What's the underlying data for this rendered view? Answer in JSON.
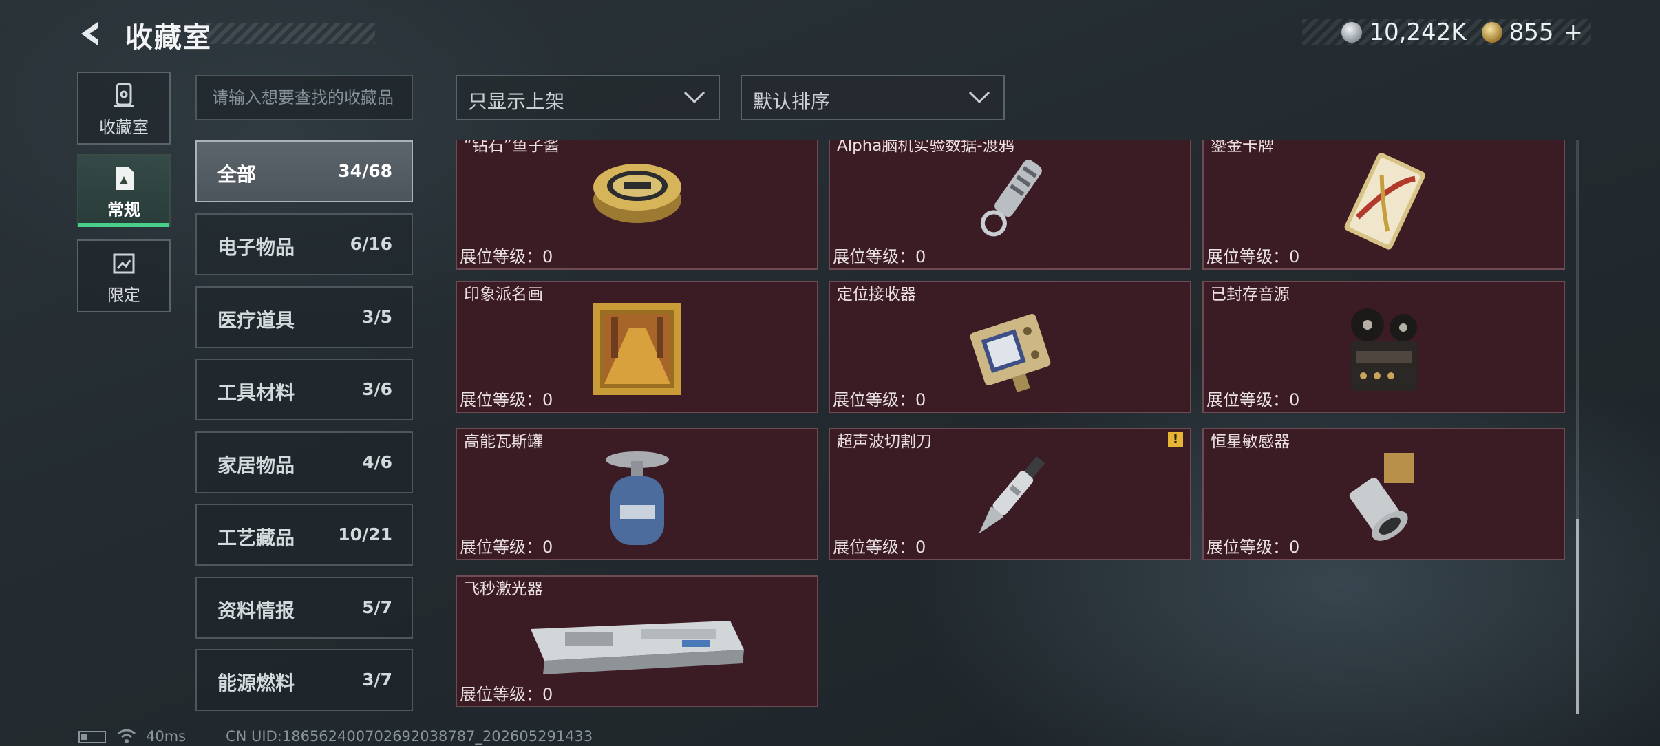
{
  "header": {
    "title": "收藏室"
  },
  "currency": {
    "silver": "10,242K",
    "gold": "855",
    "add": "+"
  },
  "left_nav": [
    {
      "label": "收藏室",
      "icon": "collection-room-icon",
      "active": false
    },
    {
      "label": "常规",
      "icon": "regular-icon",
      "active": true
    },
    {
      "label": "限定",
      "icon": "limited-icon",
      "active": false
    }
  ],
  "search": {
    "placeholder": "请输入想要查找的收藏品"
  },
  "filter": {
    "label": "只显示上架"
  },
  "sort": {
    "label": "默认排序"
  },
  "categories": [
    {
      "name": "全部",
      "count": "34/68",
      "active": true
    },
    {
      "name": "电子物品",
      "count": "6/16"
    },
    {
      "name": "医疗道具",
      "count": "3/5"
    },
    {
      "name": "工具材料",
      "count": "3/6"
    },
    {
      "name": "家居物品",
      "count": "4/6"
    },
    {
      "name": "工艺藏品",
      "count": "10/21"
    },
    {
      "name": "资料情报",
      "count": "5/7"
    },
    {
      "name": "能源燃料",
      "count": "3/7"
    }
  ],
  "items": [
    {
      "name": "“钻石”鱼子酱",
      "level": "展位等级：0",
      "icon": "caviar-tin-icon"
    },
    {
      "name": "Alpha脑机实验数据-渡鸦",
      "level": "展位等级：0",
      "icon": "data-drive-icon"
    },
    {
      "name": "鎏金卡牌",
      "level": "展位等级：0",
      "icon": "gilded-card-icon"
    },
    {
      "name": "印象派名画",
      "level": "展位等级：0",
      "icon": "framed-painting-icon"
    },
    {
      "name": "定位接收器",
      "level": "展位等级：0",
      "icon": "locator-receiver-icon"
    },
    {
      "name": "已封存音源",
      "level": "展位等级：0",
      "icon": "reel-recorder-icon"
    },
    {
      "name": "高能瓦斯罐",
      "level": "展位等级：0",
      "icon": "gas-canister-icon"
    },
    {
      "name": "超声波切割刀",
      "level": "展位等级：0",
      "icon": "ultrasonic-cutter-icon",
      "warning": "!"
    },
    {
      "name": "恒星敏感器",
      "level": "展位等级：0",
      "icon": "star-sensor-icon"
    },
    {
      "name": "飞秒激光器",
      "level": "展位等级：0",
      "icon": "femtosecond-laser-icon"
    }
  ],
  "status": {
    "ping": "40ms",
    "uid": "CN UID:18656240070269203878​7_202605291433"
  }
}
